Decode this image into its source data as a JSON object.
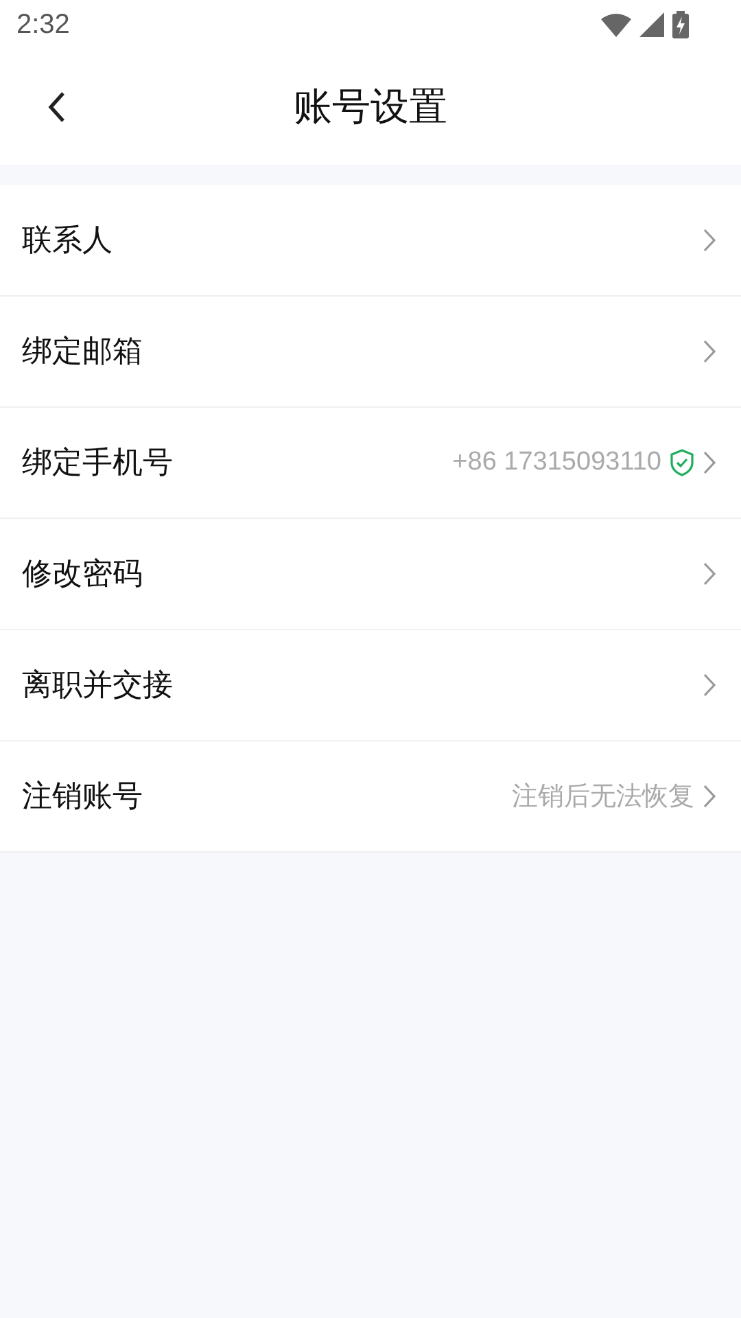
{
  "status_bar": {
    "time": "2:32"
  },
  "header": {
    "title": "账号设置"
  },
  "rows": [
    {
      "label": "联系人",
      "verified": false
    },
    {
      "label": "绑定邮箱",
      "verified": false
    },
    {
      "label": "绑定手机号",
      "value": "+86 17315093110",
      "verified": true
    },
    {
      "label": "修改密码",
      "verified": false
    },
    {
      "label": "离职并交接",
      "verified": false
    },
    {
      "label": "注销账号",
      "value": "注销后无法恢复",
      "verified": false
    }
  ]
}
